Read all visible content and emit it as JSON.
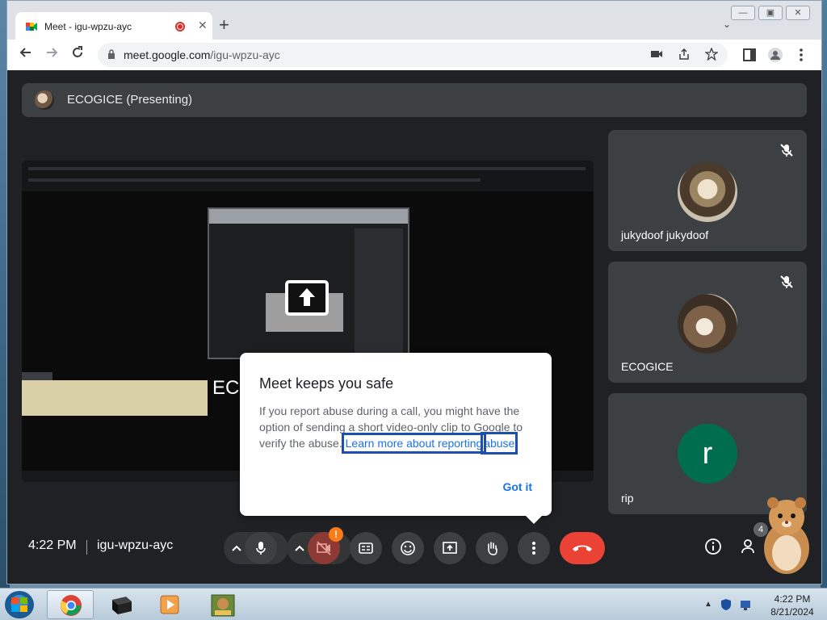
{
  "browser": {
    "tab_title": "Meet - igu-wpzu-ayc",
    "tab_close": "✕",
    "new_tab": "+",
    "tab_search": "⌄",
    "url_host": "meet.google.com",
    "url_path": "/igu-wpzu-ayc",
    "window_controls": [
      "—",
      "▣",
      "✕"
    ]
  },
  "meet": {
    "presenter_label": "ECOGICE (Presenting)",
    "shared_screen_text": "ECO",
    "participants": [
      {
        "name": "jukydoof jukydoof",
        "avatar": "photo",
        "muted": true
      },
      {
        "name": "ECOGICE",
        "avatar": "photo",
        "muted": true
      },
      {
        "name": "rip",
        "avatar": "letter",
        "letter": "r",
        "muted": false
      }
    ],
    "clock": "4:22 PM",
    "divider": "|",
    "meeting_code": "igu-wpzu-ayc",
    "camera_badge": "!",
    "people_count": "4",
    "controls": [
      "mic",
      "camera-off",
      "captions",
      "emoji",
      "present",
      "raise-hand",
      "more-options",
      "leave-call",
      "info",
      "people"
    ]
  },
  "popup": {
    "title": "Meet keeps you safe",
    "body": "If you report abuse during a call, you might have the option of sending a short video-only clip to Google to verify the abuse.",
    "link_part1": "Learn more about reporting",
    "link_part2": "abuse",
    "got_it": "Got it"
  },
  "taskbar": {
    "apps": [
      "start",
      "chrome",
      "app-black",
      "media-player",
      "game-box"
    ],
    "time": "4:22 PM",
    "date": "8/21/2024",
    "tray_arrow": "▲"
  },
  "colors": {
    "meet_bg": "#202124",
    "tile_bg": "#3c4043",
    "leave_red": "#ea4335",
    "link_blue": "#1a73e8",
    "highlight_outline": "#1c4fb0",
    "avatar_green": "#006d4e",
    "badge_orange": "#fa7b17"
  }
}
